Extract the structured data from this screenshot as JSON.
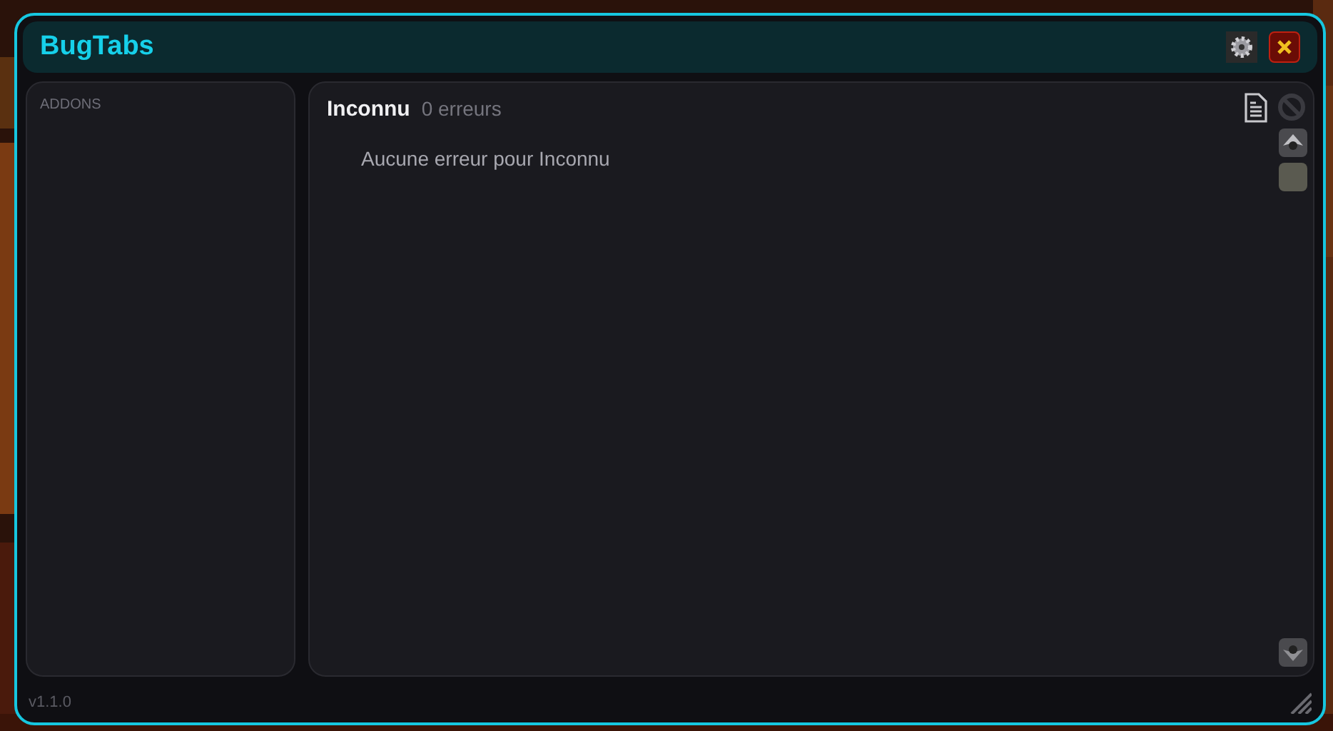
{
  "window": {
    "title": "BugTabs"
  },
  "sidebar": {
    "heading": "ADDONS"
  },
  "panel": {
    "title": "Inconnu",
    "count": "0 erreurs",
    "message": "Aucune erreur pour Inconnu",
    "clear_disabled": true
  },
  "status_bar": {
    "version": "v1.1.0"
  }
}
